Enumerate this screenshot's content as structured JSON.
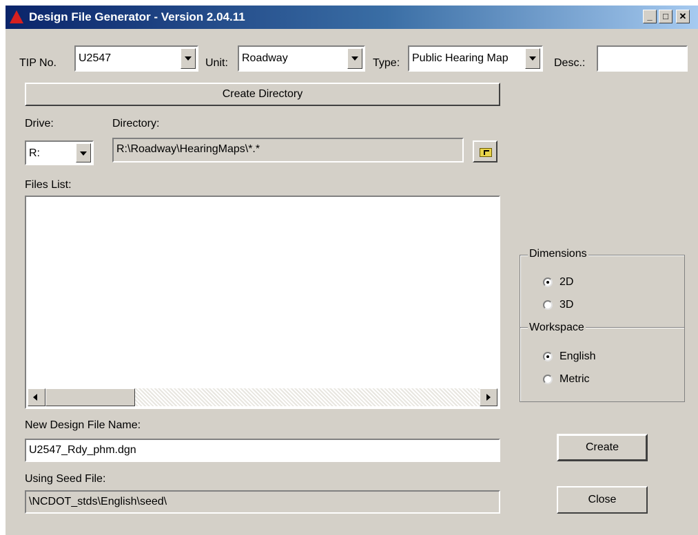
{
  "window": {
    "title": "Design File Generator - Version 2.04.11",
    "minimize": "_",
    "maximize": "□",
    "close": "✕"
  },
  "top_row": {
    "tip_label": "TIP No.",
    "tip_value": "U2547",
    "unit_label": "Unit:",
    "unit_value": "Roadway",
    "type_label": "Type:",
    "type_value": "Public Hearing Map",
    "desc_label": "Desc.:",
    "desc_value": ""
  },
  "create_directory_label": "Create Directory",
  "drive": {
    "label": "Drive:",
    "value": "R:"
  },
  "directory": {
    "label": "Directory:",
    "value": "R:\\Roadway\\HearingMaps\\*.*"
  },
  "files_list": {
    "label": "Files List:",
    "items": []
  },
  "dimensions": {
    "label": "Dimensions",
    "options": [
      {
        "label": "2D",
        "selected": true
      },
      {
        "label": "3D",
        "selected": false
      }
    ]
  },
  "workspace": {
    "label": "Workspace",
    "options": [
      {
        "label": "English",
        "selected": true
      },
      {
        "label": "Metric",
        "selected": false
      }
    ]
  },
  "new_design_file": {
    "label": "New Design File Name:",
    "value": "U2547_Rdy_phm.dgn"
  },
  "seed_file": {
    "label": "Using Seed File:",
    "value": "\\NCDOT_stds\\English\\seed\\"
  },
  "buttons": {
    "create": "Create",
    "close": "Close"
  },
  "colors": {
    "face": "#d4d0c8",
    "title_start": "#0a246a",
    "title_end": "#a6caf0"
  }
}
